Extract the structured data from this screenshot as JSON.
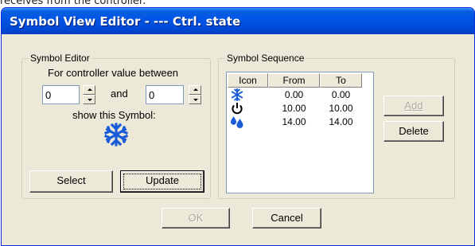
{
  "background_text": "receives from the controller.",
  "window": {
    "title": "Symbol View Editor - --- Ctrl. state"
  },
  "symbol_editor": {
    "legend": "Symbol Editor",
    "range_label": "For controller value between",
    "and_label": "and",
    "from_value": "0",
    "to_value": "0",
    "show_label": "show this Symbol:",
    "preview_icon": "snowflake-icon",
    "select_label": "Select",
    "update_label": "Update"
  },
  "symbol_sequence": {
    "legend": "Symbol Sequence",
    "columns": [
      "Icon",
      "From",
      "To"
    ],
    "rows": [
      {
        "icon": "snowflake-icon",
        "from": "0.00",
        "to": "0.00"
      },
      {
        "icon": "power-icon",
        "from": "10.00",
        "to": "10.00"
      },
      {
        "icon": "water-drops-icon",
        "from": "14.00",
        "to": "14.00"
      }
    ],
    "add_label": "Add",
    "delete_label": "Delete"
  },
  "footer": {
    "ok_label": "OK",
    "cancel_label": "Cancel"
  },
  "colors": {
    "title_bar": "#0055e5",
    "window_face": "#ece9d8",
    "icon_blue": "#1a5bd8"
  }
}
